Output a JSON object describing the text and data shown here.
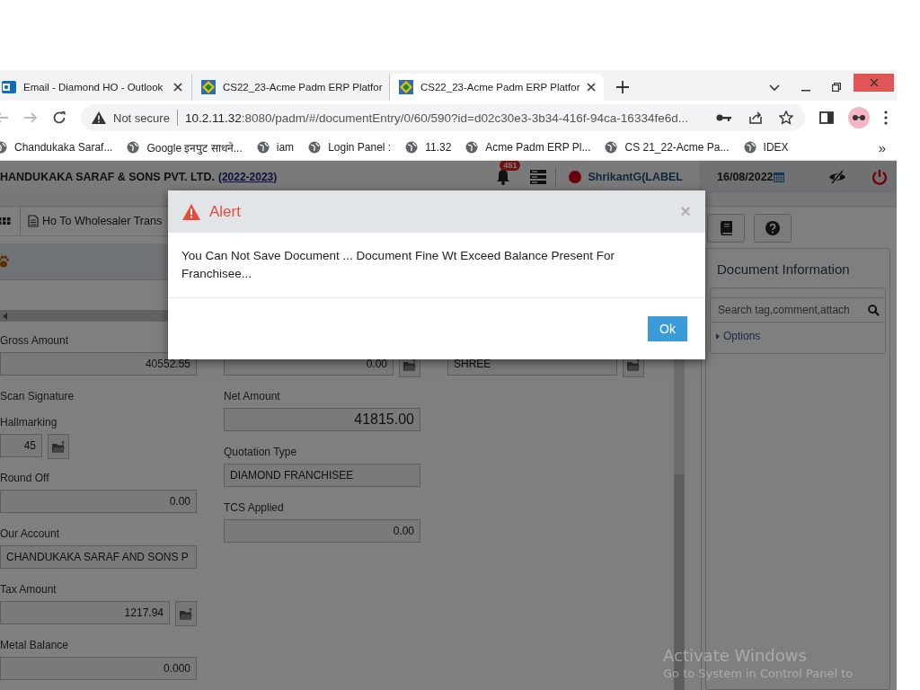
{
  "browser": {
    "tabs": [
      {
        "title": "Email - Diamond HO - Outlook",
        "selected": false
      },
      {
        "title": "CS22_23-Acme Padm ERP Platfor",
        "selected": false
      },
      {
        "title": "CS22_23-Acme Padm ERP Platfor",
        "selected": true
      }
    ],
    "security": "Not secure",
    "url_host": "10.2.11.32",
    "url_rest": ":8080/padm/#/documentEntry/0/60/590?id=d02c30e3-3b34-416f-94ca-16334fe6d...",
    "bookmarks": [
      "Chandukaka Saraf...",
      "Google इनपुट साधने...",
      "iam",
      "Login Panel :",
      "11.32",
      "Acme Padm ERP Pl...",
      "CS 21_22-Acme Pa...",
      "IDEX"
    ],
    "bookmarks_more": "»"
  },
  "app": {
    "company": "HANDUKAKA SARAF & SONS PVT. LTD.",
    "year": "(2022-2023)",
    "notifications": "451",
    "user": "ShrikantG(LABEL",
    "date": "16/08/2022",
    "breadcrumb": "Ho To Wholesaler Trans",
    "form_columns": [
      [
        {
          "kind": "number",
          "label": "Gross Amount",
          "value": "40552.55"
        },
        {
          "kind": "label",
          "label": "Scan Signature"
        },
        {
          "kind": "short-button",
          "label": "Hallmarking",
          "value": "45"
        },
        {
          "kind": "number",
          "label": "Round Off",
          "value": "0.00"
        },
        {
          "kind": "text",
          "label": "Our Account",
          "value": "CHANDUKAKA SARAF AND SONS P"
        },
        {
          "kind": "number-button",
          "label": "Tax Amount",
          "value": "1217.94"
        },
        {
          "kind": "number",
          "label": "Metal Balance",
          "value": "0.000"
        }
      ],
      [
        {
          "kind": "number-button",
          "value": "0.00"
        },
        {
          "kind": "total",
          "label": "Net Amount",
          "value": "41815.00"
        },
        {
          "kind": "text",
          "label": "Quotation Type",
          "value": "DIAMOND FRANCHISEE"
        },
        {
          "kind": "number",
          "label": "TCS Applied",
          "value": "0.00"
        }
      ],
      [
        {
          "kind": "text-button",
          "value": "SHREE"
        }
      ]
    ],
    "side_panel": {
      "title": "Document Information",
      "search_placeholder": "Search tag,comment,attach",
      "options": "Options"
    }
  },
  "dialog": {
    "title": "Alert",
    "message": "You Can Not Save Document ... Document Fine Wt Exceed Balance Present For Franchisee...",
    "close": "×",
    "button": "Ok"
  },
  "os_notice": {
    "title": "Activate Windows",
    "text": "Go to System in Control Panel to"
  }
}
